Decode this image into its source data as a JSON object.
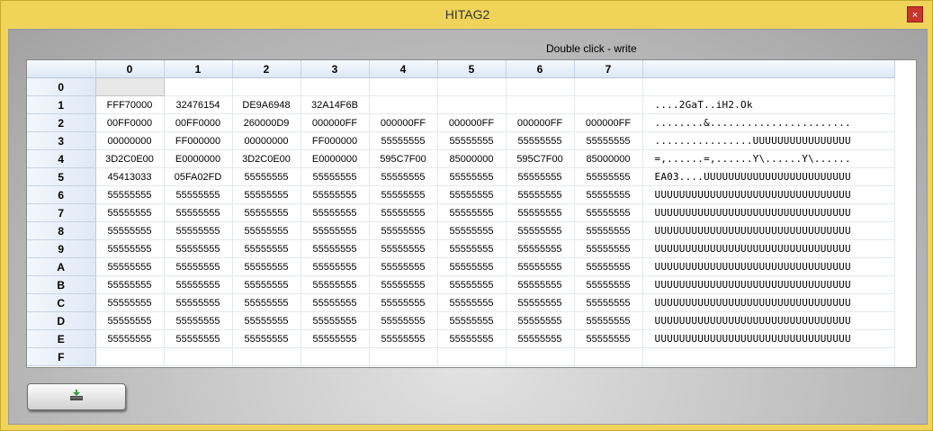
{
  "window": {
    "title": "HITAG2",
    "close_glyph": "×"
  },
  "hint": "Double click - write",
  "columns": [
    "0",
    "1",
    "2",
    "3",
    "4",
    "5",
    "6",
    "7",
    ""
  ],
  "rows": [
    {
      "label": "0",
      "cells": [
        "",
        "",
        "",
        "",
        "",
        "",
        "",
        ""
      ],
      "ascii": ""
    },
    {
      "label": "1",
      "cells": [
        "FFF70000",
        "32476154",
        "DE9A6948",
        "32A14F6B",
        "",
        "",
        "",
        ""
      ],
      "ascii": "....2GaT..iH2.Ok"
    },
    {
      "label": "2",
      "cells": [
        "00FF0000",
        "00FF0000",
        "260000D9",
        "000000FF",
        "000000FF",
        "000000FF",
        "000000FF",
        "000000FF"
      ],
      "ascii": "........&......................."
    },
    {
      "label": "3",
      "cells": [
        "00000000",
        "FF000000",
        "00000000",
        "FF000000",
        "55555555",
        "55555555",
        "55555555",
        "55555555"
      ],
      "ascii": "................UUUUUUUUUUUUUUUU"
    },
    {
      "label": "4",
      "cells": [
        "3D2C0E00",
        "E0000000",
        "3D2C0E00",
        "E0000000",
        "595C7F00",
        "85000000",
        "595C7F00",
        "85000000"
      ],
      "ascii": "=,......=,......Y\\......Y\\......"
    },
    {
      "label": "5",
      "cells": [
        "45413033",
        "05FA02FD",
        "55555555",
        "55555555",
        "55555555",
        "55555555",
        "55555555",
        "55555555"
      ],
      "ascii": "EA03....UUUUUUUUUUUUUUUUUUUUUUUU"
    },
    {
      "label": "6",
      "cells": [
        "55555555",
        "55555555",
        "55555555",
        "55555555",
        "55555555",
        "55555555",
        "55555555",
        "55555555"
      ],
      "ascii": "UUUUUUUUUUUUUUUUUUUUUUUUUUUUUUUU"
    },
    {
      "label": "7",
      "cells": [
        "55555555",
        "55555555",
        "55555555",
        "55555555",
        "55555555",
        "55555555",
        "55555555",
        "55555555"
      ],
      "ascii": "UUUUUUUUUUUUUUUUUUUUUUUUUUUUUUUU"
    },
    {
      "label": "8",
      "cells": [
        "55555555",
        "55555555",
        "55555555",
        "55555555",
        "55555555",
        "55555555",
        "55555555",
        "55555555"
      ],
      "ascii": "UUUUUUUUUUUUUUUUUUUUUUUUUUUUUUUU"
    },
    {
      "label": "9",
      "cells": [
        "55555555",
        "55555555",
        "55555555",
        "55555555",
        "55555555",
        "55555555",
        "55555555",
        "55555555"
      ],
      "ascii": "UUUUUUUUUUUUUUUUUUUUUUUUUUUUUUUU"
    },
    {
      "label": "A",
      "cells": [
        "55555555",
        "55555555",
        "55555555",
        "55555555",
        "55555555",
        "55555555",
        "55555555",
        "55555555"
      ],
      "ascii": "UUUUUUUUUUUUUUUUUUUUUUUUUUUUUUUU"
    },
    {
      "label": "B",
      "cells": [
        "55555555",
        "55555555",
        "55555555",
        "55555555",
        "55555555",
        "55555555",
        "55555555",
        "55555555"
      ],
      "ascii": "UUUUUUUUUUUUUUUUUUUUUUUUUUUUUUUU"
    },
    {
      "label": "C",
      "cells": [
        "55555555",
        "55555555",
        "55555555",
        "55555555",
        "55555555",
        "55555555",
        "55555555",
        "55555555"
      ],
      "ascii": "UUUUUUUUUUUUUUUUUUUUUUUUUUUUUUUU"
    },
    {
      "label": "D",
      "cells": [
        "55555555",
        "55555555",
        "55555555",
        "55555555",
        "55555555",
        "55555555",
        "55555555",
        "55555555"
      ],
      "ascii": "UUUUUUUUUUUUUUUUUUUUUUUUUUUUUUUU"
    },
    {
      "label": "E",
      "cells": [
        "55555555",
        "55555555",
        "55555555",
        "55555555",
        "55555555",
        "55555555",
        "55555555",
        "55555555"
      ],
      "ascii": "UUUUUUUUUUUUUUUUUUUUUUUUUUUUUUUU"
    },
    {
      "label": "F",
      "cells": [
        "",
        "",
        "",
        "",
        "",
        "",
        "",
        ""
      ],
      "ascii": ""
    }
  ],
  "selected_cell": {
    "row": "0",
    "col": "0"
  },
  "write_button": {
    "icon": "write-to-tag-icon"
  },
  "colors": {
    "titlebar": "#f0d45a",
    "close": "#c7352c",
    "header_blue": "#dde8f6"
  }
}
